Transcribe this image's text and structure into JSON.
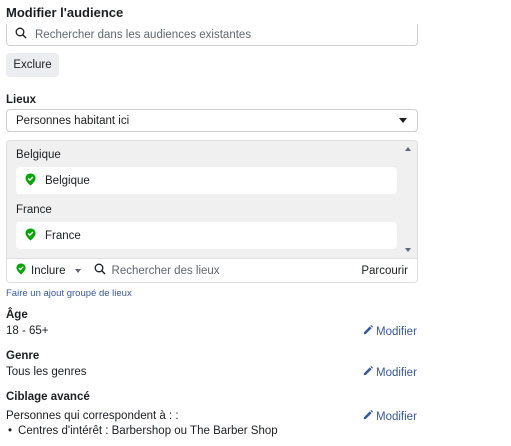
{
  "title": "Modifier l'audience",
  "search": {
    "placeholder": "Rechercher dans les audiences existantes"
  },
  "exclude_button": "Exclure",
  "locations": {
    "section_label": "Lieux",
    "type_dropdown": "Personnes habitant ici",
    "groups": [
      {
        "country": "Belgique",
        "chip": "Belgique"
      },
      {
        "country": "France",
        "chip": "France"
      }
    ],
    "include_label": "Inclure",
    "search_placeholder": "Rechercher des lieux",
    "browse_label": "Parcourir",
    "bulk_link": "Faire un ajout groupé de lieux"
  },
  "age": {
    "label": "Âge",
    "value": "18 - 65+",
    "edit": "Modifier"
  },
  "gender": {
    "label": "Genre",
    "value": "Tous les genres",
    "edit": "Modifier"
  },
  "targeting": {
    "label": "Ciblage avancé",
    "match_text": "Personnes qui correspondent à : :",
    "bullet": "•",
    "interest": "Centres d'intérêt : Barbershop ou The Barber Shop",
    "edit": "Modifier"
  },
  "colors": {
    "link": "#385898",
    "pin_green": "#00a400",
    "panel_bg": "#f0f0f0"
  }
}
